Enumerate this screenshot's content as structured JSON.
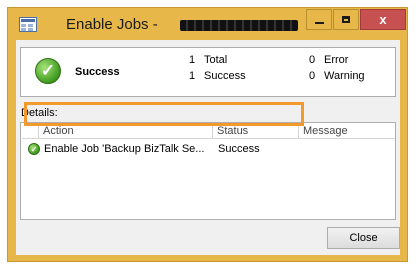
{
  "window": {
    "title": "Enable Jobs - ",
    "close_glyph": "x"
  },
  "summary": {
    "status": "Success",
    "total_count": "1",
    "total_label": "Total",
    "success_count": "1",
    "success_label": "Success",
    "error_count": "0",
    "error_label": "Error",
    "warning_count": "0",
    "warning_label": "Warning"
  },
  "details": {
    "label": "Details:",
    "columns": [
      "Action",
      "Status",
      "Message"
    ],
    "rows": [
      {
        "action": "Enable Job 'Backup BizTalk Se...",
        "status": "Success",
        "message": ""
      }
    ]
  },
  "buttons": {
    "close": "Close"
  },
  "icons": {
    "app": "app-window-icon",
    "success": "success-check-icon",
    "row_status": "success-check-icon"
  },
  "colors": {
    "frame": "#e8b74a",
    "close_button": "#c75050",
    "highlight": "#f39a2e",
    "success_green": "#3f9a1e"
  }
}
